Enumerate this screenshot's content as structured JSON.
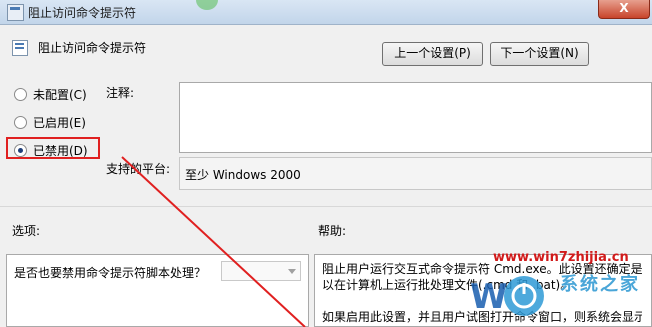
{
  "window": {
    "title": "阻止访问命令提示符",
    "close_label": "X"
  },
  "header": {
    "title": "阻止访问命令提示符"
  },
  "nav": {
    "prev_label": "上一个设置(P)",
    "next_label": "下一个设置(N)"
  },
  "state_options": [
    {
      "label": "未配置(C)",
      "checked": false
    },
    {
      "label": "已启用(E)",
      "checked": false
    },
    {
      "label": "已禁用(D)",
      "checked": true
    }
  ],
  "comment": {
    "label": "注释:",
    "value": ""
  },
  "platform": {
    "label": "支持的平台:",
    "value": "至少 Windows 2000"
  },
  "options": {
    "label": "选项:",
    "question": "是否也要禁用命令提示符脚本处理？",
    "selected_value": ""
  },
  "help": {
    "label": "帮助:",
    "lines": [
      "阻止用户运行交互式命令提示符 Cmd.exe。此设置还确定是否",
      "以在计算机上运行批处理文件(.cmd 和 .bat)。",
      "",
      "如果启用此设置，并且用户试图打开命令窗口，则系统会显示"
    ]
  },
  "watermark": {
    "url": "www.win7zhijia.cn",
    "logo_text": "W",
    "brand": "系统之家",
    "sub": ""
  },
  "colors": {
    "highlight": "#e02020",
    "accent": "#4a7ab3"
  }
}
